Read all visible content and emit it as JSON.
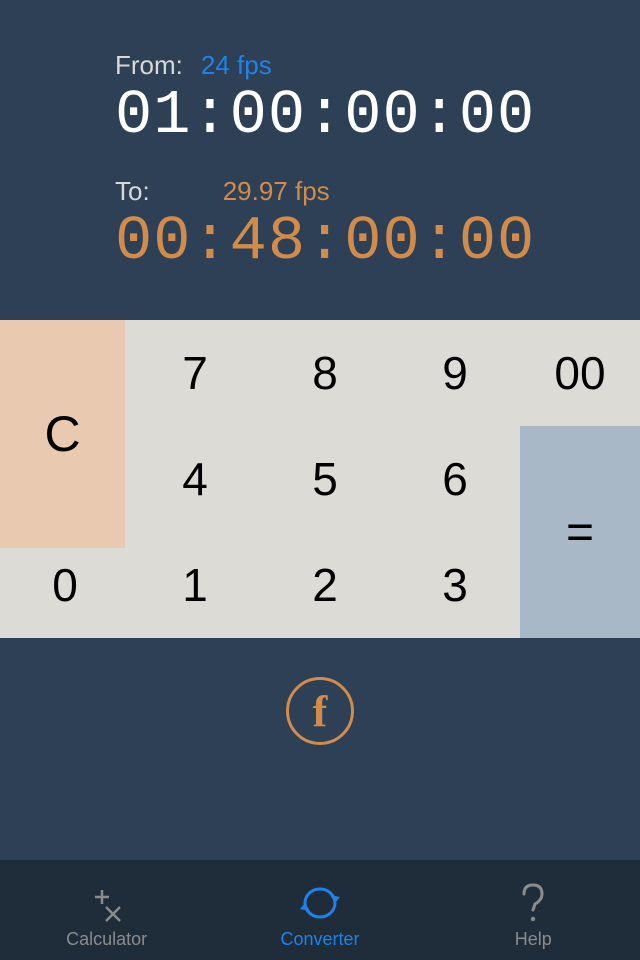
{
  "from": {
    "label": "From:",
    "fps": "24 fps",
    "timecode": "01:00:00:00"
  },
  "to": {
    "label": "To:",
    "fps": "29.97 fps",
    "timecode": "00:48:00:00"
  },
  "keys": {
    "clear": "C",
    "k0": "0",
    "k1": "1",
    "k2": "2",
    "k3": "3",
    "k4": "4",
    "k5": "5",
    "k6": "6",
    "k7": "7",
    "k8": "8",
    "k9": "9",
    "k00": "00",
    "eq": "="
  },
  "function_button": "f",
  "tabs": {
    "calculator": "Calculator",
    "converter": "Converter",
    "help": "Help"
  }
}
